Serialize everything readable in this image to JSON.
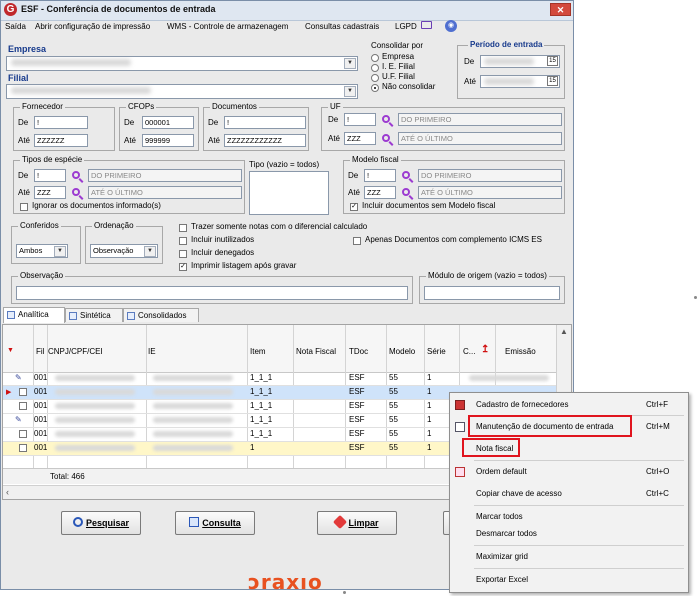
{
  "window": {
    "title": "ESF - Conferência de documentos de entrada",
    "logo_letter": "G",
    "controls": {
      "minimize": "–",
      "maximize": "□",
      "close": "✕"
    }
  },
  "menu": [
    {
      "label": "Saída"
    },
    {
      "label": "Abrir configuração de impressão"
    },
    {
      "label": "WMS - Controle de armazenagem"
    },
    {
      "label": "Consultas cadastrais"
    },
    {
      "label": "LGPD"
    }
  ],
  "filters": {
    "empresa_label": "Empresa",
    "filial_label": "Filial",
    "consolidar": {
      "title": "Consolidar por",
      "options": [
        "Empresa",
        "I. E. Filial",
        "U.F. Filial",
        "Não consolidar"
      ],
      "selected": "Não consolidar"
    },
    "periodo": {
      "title": "Período de entrada",
      "de_label": "De",
      "ate_label": "Até"
    },
    "fornecedor": {
      "title": "Fornecedor",
      "de_label": "De",
      "de_value": "!",
      "ate_label": "Até",
      "ate_value": "ZZZZZZ"
    },
    "cfops": {
      "title": "CFOPs",
      "de_label": "De",
      "de_value": "000001",
      "ate_label": "Até",
      "ate_value": "999999"
    },
    "documentos": {
      "title": "Documentos",
      "de_label": "De",
      "de_value": "!",
      "ate_label": "Até",
      "ate_value": "ZZZZZZZZZZZZ"
    },
    "uf": {
      "title": "UF",
      "de_label": "De",
      "de_value": "!",
      "de_desc": "DO PRIMEIRO",
      "ate_label": "Até",
      "ate_value": "ZZZ",
      "ate_desc": "ATÉ O ÚLTIMO"
    },
    "tipos_especie": {
      "title": "Tipos de espécie",
      "de_label": "De",
      "de_value": "!",
      "de_desc": "DO PRIMEIRO",
      "ate_label": "Até",
      "ate_value": "ZZZ",
      "ate_desc": "ATÉ O ÚLTIMO",
      "ignore_label": "Ignorar os documentos informado(s)"
    },
    "tipo": {
      "title": "Tipo (vazio = todos)"
    },
    "modelo_fiscal": {
      "title": "Modelo fiscal",
      "de_label": "De",
      "de_value": "!",
      "de_desc": "DO PRIMEIRO",
      "ate_label": "Até",
      "ate_value": "ZZZ",
      "ate_desc": "ATÉ O ÚLTIMO",
      "include_label": "Incluir documentos sem Modelo fiscal",
      "include_checked": true
    },
    "conferidos": {
      "title": "Conferidos",
      "value": "Ambos"
    },
    "ordenacao": {
      "title": "Ordenação",
      "value": "Observação"
    },
    "checkboxes": [
      {
        "label": "Trazer somente notas com o diferencial calculado",
        "checked": false
      },
      {
        "label": "Incluir inutilizados",
        "checked": false
      },
      {
        "label": "Incluir denegados",
        "checked": false
      },
      {
        "label": "Imprimir listagem após gravar",
        "checked": true
      }
    ],
    "complemento_icms": {
      "label": "Apenas Documentos com complemento ICMS ES",
      "checked": false
    },
    "observacao_label": "Observação",
    "modulo_origem_label": "Módulo de origem (vazio = todos)"
  },
  "tabs": [
    {
      "label": "Analítica",
      "active": true
    },
    {
      "label": "Sintética",
      "active": false
    },
    {
      "label": "Consolidados",
      "active": false
    }
  ],
  "grid": {
    "columns": [
      "Fil",
      "CNPJ/CPF/CEI",
      "IE",
      "Item",
      "Nota Fiscal",
      "TDoc",
      "Modelo",
      "Série",
      "C...",
      "Emissão"
    ],
    "rows": [
      {
        "fil": "001",
        "item": "1_1_1",
        "tdoc": "ESF",
        "modelo": "55",
        "serie": "1",
        "selected": false
      },
      {
        "fil": "001",
        "item": "1_1_1",
        "tdoc": "ESF",
        "modelo": "55",
        "serie": "1",
        "selected": true
      },
      {
        "fil": "001",
        "item": "1_1_1",
        "tdoc": "ESF",
        "modelo": "55",
        "serie": "1",
        "selected": false
      },
      {
        "fil": "001",
        "item": "1_1_1",
        "tdoc": "ESF",
        "modelo": "55",
        "serie": "1",
        "selected": false
      },
      {
        "fil": "001",
        "item": "1_1_1",
        "tdoc": "ESF",
        "modelo": "55",
        "serie": "1",
        "selected": false
      },
      {
        "fil": "001",
        "item": "1",
        "tdoc": "ESF",
        "modelo": "55",
        "serie": "1",
        "selected": false
      }
    ],
    "total": "Total: 466"
  },
  "buttons": {
    "pesquisar": "Pesquisar",
    "consulta": "Consulta",
    "limpar": "Limpar"
  },
  "context_menu": [
    {
      "label": "Cadastro de fornecedores",
      "shortcut": "Ctrl+F",
      "icon": "gift-icon"
    },
    {
      "label": "Manutenção de documento de entrada",
      "shortcut": "Ctrl+M",
      "icon": "document-edit-icon",
      "highlighted": true
    },
    {
      "label": "Nota fiscal",
      "shortcut": "",
      "icon": "",
      "highlighted": true
    },
    {
      "label": "Ordem default",
      "shortcut": "Ctrl+O",
      "icon": "sort-icon"
    },
    {
      "label": "Copiar chave de acesso",
      "shortcut": "Ctrl+C",
      "icon": ""
    },
    {
      "label": "Marcar todos",
      "shortcut": "",
      "icon": ""
    },
    {
      "label": "Desmarcar todos",
      "shortcut": "",
      "icon": ""
    },
    {
      "label": "Maximizar grid",
      "shortcut": "",
      "icon": ""
    },
    {
      "label": "Exportar Excel",
      "shortcut": "",
      "icon": ""
    }
  ],
  "brand": "ɔraxıo",
  "colors": {
    "accent": "#173a8c",
    "highlight": "#e0141e",
    "brand": "#e85120",
    "selection": "#cfe3fa"
  }
}
